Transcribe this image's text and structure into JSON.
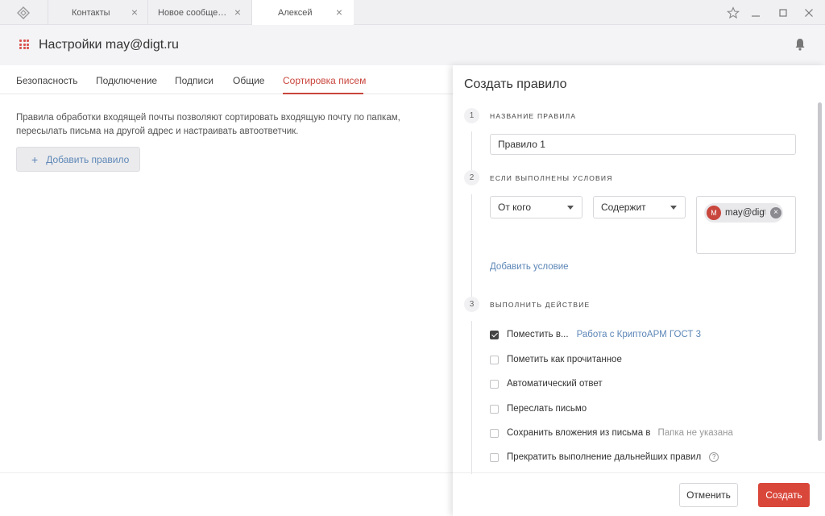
{
  "titlebar": {
    "tabs": [
      {
        "label": "Контакты"
      },
      {
        "label": "Новое сообщение"
      },
      {
        "label": "Алексей"
      }
    ],
    "close_glyph": "×",
    "icons": [
      "app-logo-icon",
      "star-icon",
      "minimize-icon",
      "maximize-icon",
      "close-icon"
    ]
  },
  "header": {
    "title": "Настройки may@digt.ru"
  },
  "settings_tabs": [
    {
      "label": "Безопасность"
    },
    {
      "label": "Подключение"
    },
    {
      "label": "Подписи"
    },
    {
      "label": "Общие"
    },
    {
      "label": "Сортировка писем"
    }
  ],
  "main": {
    "description": "Правила обработки входящей почты позволяют сортировать входящую почту по папкам, пересылать письма на другой адрес и настраивать автоответчик.",
    "add_rule_label": "Добавить правило",
    "add_rule_plus": "+"
  },
  "panel": {
    "title": "Создать правило",
    "steps": [
      {
        "number": "1",
        "label": "Название правила"
      },
      {
        "number": "2",
        "label": "Если выполнены условия"
      },
      {
        "number": "3",
        "label": "Выполнить действие"
      }
    ],
    "rule_name_value": "Правило 1",
    "condition": {
      "field": "От кого",
      "operator": "Содержит",
      "chip_avatar": "M",
      "chip_text": "may@digt.ru",
      "chip_remove": "×"
    },
    "add_condition_label": "Добавить условие",
    "actions": [
      {
        "label": "Поместить в...",
        "checked": true,
        "extra": "Работа с КриптоАРМ ГОСТ 3",
        "extra_type": "link"
      },
      {
        "label": "Пометить как прочитанное",
        "checked": false
      },
      {
        "label": "Автоматический ответ",
        "checked": false
      },
      {
        "label": "Переслать письмо",
        "checked": false
      },
      {
        "label": "Сохранить вложения из письма в",
        "checked": false,
        "extra": "Папка не указана",
        "extra_type": "muted"
      },
      {
        "label": "Прекратить выполнение дальнейших правил",
        "checked": false,
        "help": "?"
      }
    ],
    "cancel_label": "Отменить",
    "create_label": "Создать"
  },
  "colors": {
    "accent": "#c9463d",
    "primary_button": "#d9473a",
    "link": "#5d87b7"
  }
}
